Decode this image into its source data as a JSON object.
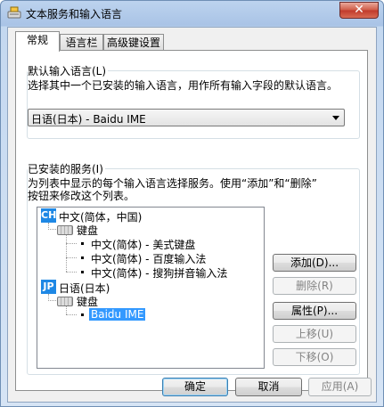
{
  "window": {
    "title": "文本服务和输入语言",
    "close_glyph": "✕"
  },
  "tabs": [
    {
      "label": "常规",
      "active": true
    },
    {
      "label": "语言栏",
      "active": false
    },
    {
      "label": "高级键设置",
      "active": false
    }
  ],
  "default_language": {
    "group_title": "默认输入语言(L)",
    "description": "选择其中一个已安装的输入语言，用作所有输入字段的默认语言。",
    "selected_value": "日语(日本) - Baidu IME"
  },
  "installed_services": {
    "group_title": "已安装的服务(I)",
    "description_line1": "为列表中显示的每个输入语言选择服务。使用“添加”和“删除”",
    "description_line2": "按钮来修改这个列表。",
    "tree": [
      {
        "badge": "CH",
        "label": "中文(简体，中国)",
        "category": "键盘",
        "items": [
          "中文(简体) - 美式键盘",
          "中文(简体) - 百度输入法",
          "中文(简体) - 搜狗拼音输入法"
        ]
      },
      {
        "badge": "JP",
        "label": "日语(日本)",
        "category": "键盘",
        "items": [
          "Baidu IME"
        ]
      }
    ],
    "selected_item": "Baidu IME",
    "buttons": {
      "add": "添加(D)...",
      "remove": "删除(R)",
      "properties": "属性(P)...",
      "move_up": "上移(U)",
      "move_down": "下移(O)"
    }
  },
  "footer": {
    "ok": "确定",
    "cancel": "取消",
    "apply": "应用(A)"
  },
  "colors": {
    "badge": "#1e88e5",
    "selection": "#3399ff",
    "close_button": "#c0392b"
  }
}
